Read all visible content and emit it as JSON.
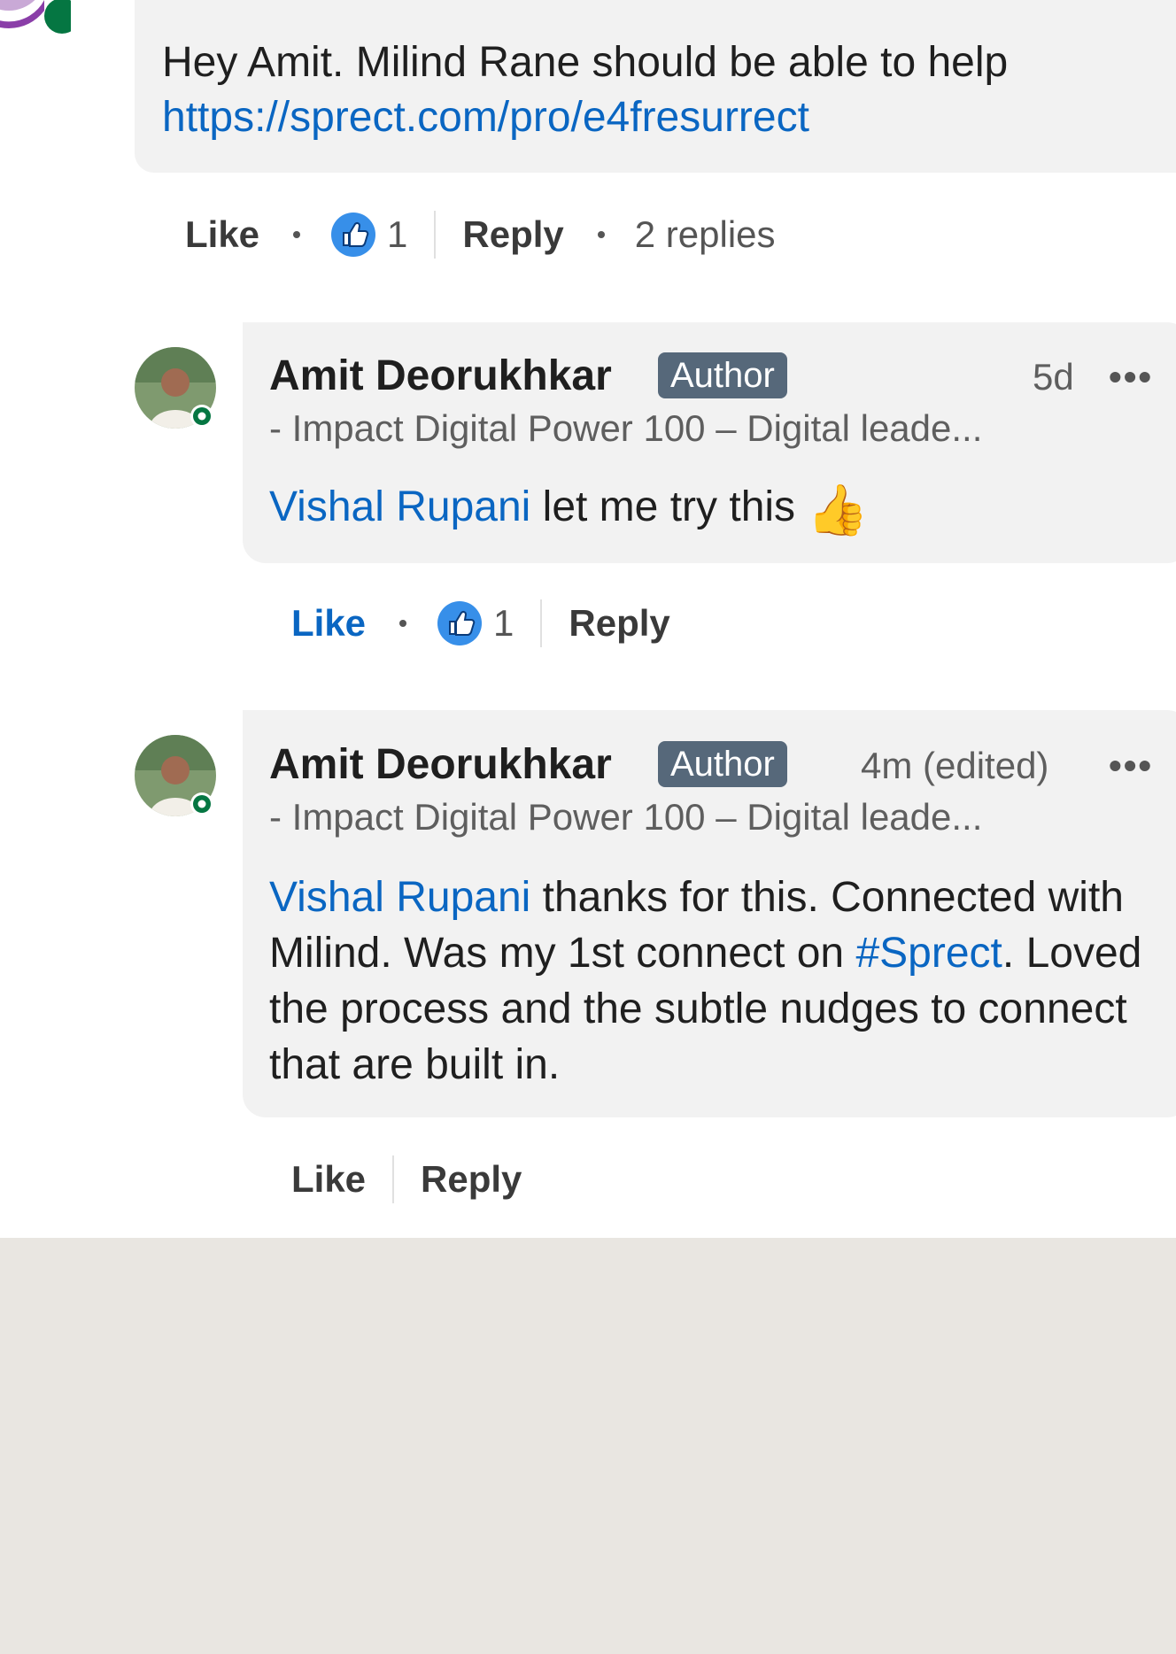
{
  "top_comment": {
    "text": "Hey Amit. Milind Rane should be able to help",
    "link": "https://sprect.com/pro/e4fresurrect",
    "actions": {
      "like": "Like",
      "reaction_count": "1",
      "reply": "Reply",
      "replies": "2 replies"
    }
  },
  "replies": [
    {
      "author": "Amit Deorukhkar",
      "badge": "Author",
      "time": "5d",
      "menu": "•••",
      "headline": "- Impact Digital Power 100 – Digital leade...",
      "mention": "Vishal Rupani",
      "text": " let me try this ",
      "emoji": "👍",
      "actions": {
        "like": "Like",
        "reaction_count": "1",
        "reply": "Reply"
      }
    },
    {
      "author": "Amit Deorukhkar",
      "badge": "Author",
      "time": "4m (edited)",
      "menu": "•••",
      "headline": "- Impact Digital Power 100 – Digital leade...",
      "mention": "Vishal Rupani",
      "text_1": " thanks for this. Connected with Milind. Was my 1st connect on ",
      "hashtag": "#Sprect",
      "text_2": ".  Loved the process and the subtle nudges to connect that are built in.",
      "actions": {
        "like": "Like",
        "reply": "Reply"
      }
    }
  ],
  "colors": {
    "link_blue": "#0a66c2",
    "bubble_grey": "#f2f2f2",
    "badge_grey": "#56687a",
    "presence_green": "#057642",
    "footer_grey": "#e9e6e1"
  }
}
